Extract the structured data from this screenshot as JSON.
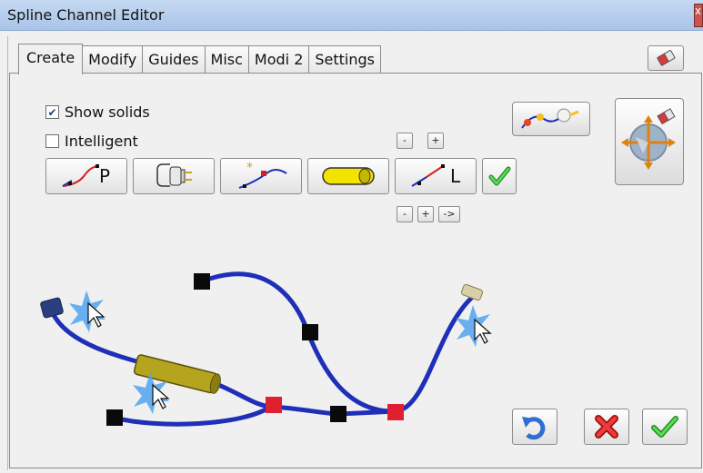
{
  "window": {
    "title": "Spline Channel Editor"
  },
  "tabs": [
    {
      "label": "Create",
      "active": true
    },
    {
      "label": "Modify"
    },
    {
      "label": "Guides"
    },
    {
      "label": "Misc"
    },
    {
      "label": "Modi 2"
    },
    {
      "label": "Settings"
    }
  ],
  "options": {
    "show_solids": {
      "label": "Show solids",
      "checked": true
    },
    "intelligent": {
      "label": "Intelligent",
      "checked": false
    }
  },
  "toolbar": {
    "point_label": "P",
    "length_label": "L",
    "minus": "-",
    "plus": "+",
    "arrow": "->"
  },
  "icons": {
    "eraser": "eraser-icon",
    "spline_p": "spline-point-icon",
    "plug": "plug-icon",
    "spline_star": "spline-insert-icon",
    "capsule": "solid-capsule-icon",
    "spline_l": "spline-length-icon",
    "confirm": "check-icon",
    "chain": "spline-chain-icon",
    "gizmo": "transform-gizmo-icon",
    "undo": "undo-icon",
    "cancel": "cancel-icon",
    "ok": "ok-icon"
  },
  "colors": {
    "spline": "#1f2fb8",
    "control_point": "#0a0a0a",
    "junction": "#e02030",
    "solid": "#b8a81c",
    "check": "#22aa22",
    "cancel": "#d42020"
  }
}
